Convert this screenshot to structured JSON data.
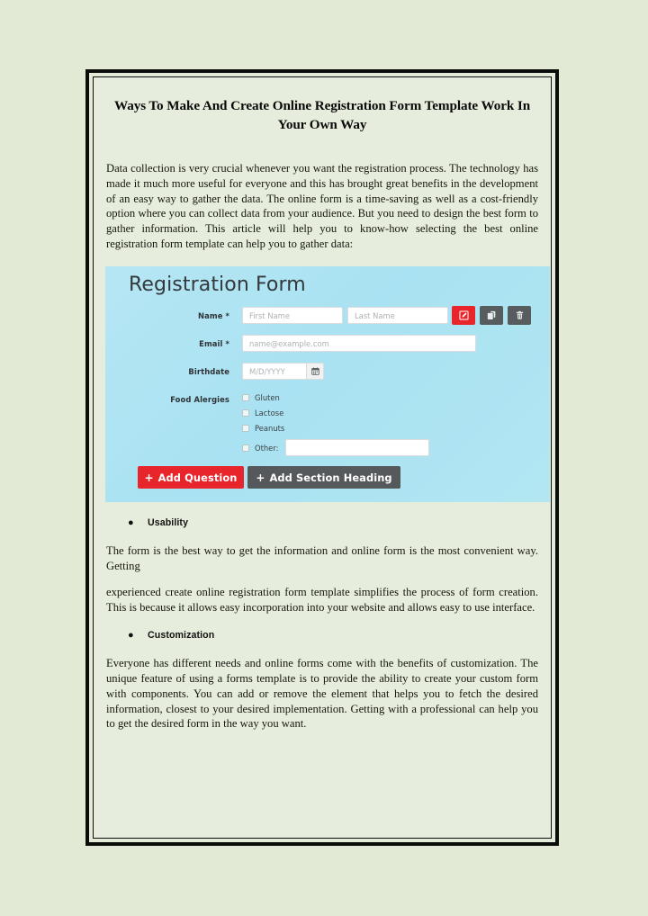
{
  "document": {
    "title": "Ways To Make And Create Online Registration Form Template Work In Your Own Way",
    "intro_paragraph": "Data collection is very crucial whenever you want the registration process. The technology has made it much more useful for everyone and this has brought great benefits in the development of an easy way to gather the data. The online form is a time-saving as well as a cost-friendly option where you can collect data from your audience. But you need to design the best form to gather information. This article will help you to know-how selecting the best online registration form template can help you to gather data:",
    "bullet_marker": "●",
    "sections": [
      {
        "heading": "Usability",
        "paragraphs": [
          "The form is the best way to get the information and online form is the most convenient way. Getting",
          "experienced create online registration form template simplifies the process of form creation. This is because it allows easy incorporation into your website and allows easy to use interface."
        ]
      },
      {
        "heading": "Customization",
        "paragraphs": [
          "Everyone has different needs and online forms come with the benefits of customization. The unique feature of using a forms template is to provide the ability to create your custom form with components. You can add or remove the element that helps you to fetch the desired information, closest to your desired implementation.  Getting with a professional can help you to get the desired form in the way you want."
        ]
      }
    ]
  },
  "form_image": {
    "title": "Registration Form",
    "fields": {
      "name": {
        "label": "Name *",
        "first_placeholder": "First Name",
        "last_placeholder": "Last Name"
      },
      "email": {
        "label": "Email *",
        "placeholder": "name@example.com"
      },
      "birthdate": {
        "label": "Birthdate",
        "placeholder": "M/D/YYYY"
      },
      "allergies": {
        "label": "Food Alergies",
        "options": [
          "Gluten",
          "Lactose",
          "Peanuts"
        ],
        "other_label": "Other:",
        "other_value": ""
      }
    },
    "toolbar": {
      "edit_icon": "edit-square-icon",
      "duplicate_icon": "duplicate-icon",
      "delete_icon": "trash-icon"
    },
    "calendar_icon": "calendar-icon",
    "buttons": {
      "add_question": "Add Question",
      "add_section_heading": "Add Section Heading",
      "plus": "+"
    },
    "colors": {
      "accent_red": "#e8252b",
      "dark_gray": "#55595b",
      "form_background": "#ace5f2"
    }
  },
  "page": {
    "background": "#e2ead6",
    "paper_background": "#e7eddc",
    "border_color": "#0b0d0a"
  }
}
